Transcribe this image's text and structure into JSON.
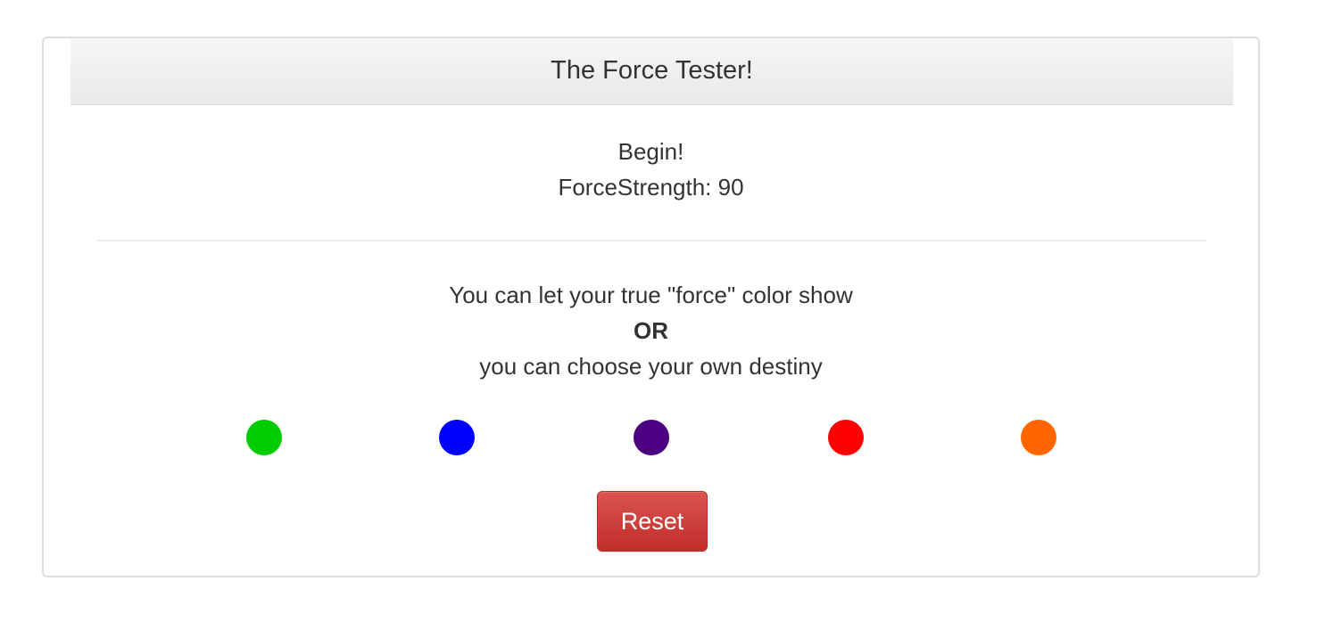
{
  "panel": {
    "title": "The Force Tester!"
  },
  "status": {
    "message": "Begin!",
    "strength_text": "ForceStrength: 90"
  },
  "prompt": {
    "line1": "You can let your true \"force\" color show",
    "or": "OR",
    "line2": "you can choose your own destiny"
  },
  "colors": [
    {
      "name": "green",
      "hex": "#00cc00"
    },
    {
      "name": "blue",
      "hex": "#0000ff"
    },
    {
      "name": "purple",
      "hex": "#4b0082"
    },
    {
      "name": "red",
      "hex": "#ff0000"
    },
    {
      "name": "orange",
      "hex": "#ff6600"
    }
  ],
  "buttons": {
    "reset_label": "Reset"
  }
}
